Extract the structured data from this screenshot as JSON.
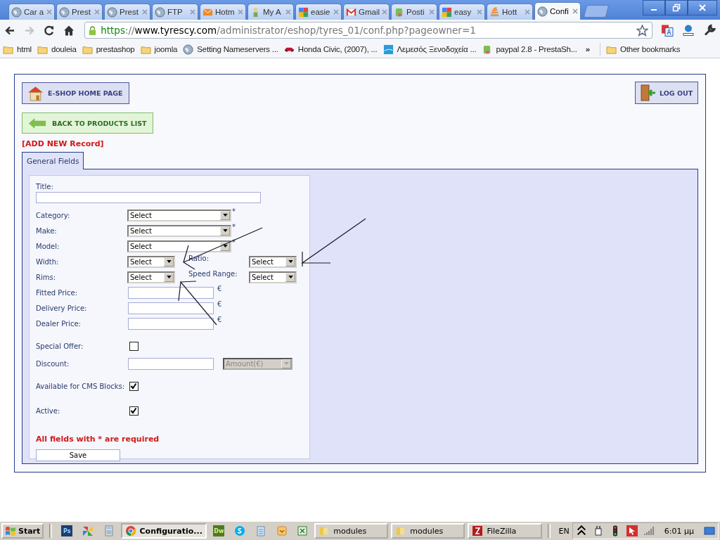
{
  "browser": {
    "tabs": [
      {
        "title": "Car a",
        "kind": "globe",
        "selected": false
      },
      {
        "title": "Prest",
        "kind": "globe",
        "selected": false
      },
      {
        "title": "Prest",
        "kind": "globe",
        "selected": false
      },
      {
        "title": "FTP",
        "kind": "globe",
        "selected": false
      },
      {
        "title": "Hotm",
        "kind": "mail",
        "selected": false
      },
      {
        "title": "My A",
        "kind": "figure",
        "selected": false
      },
      {
        "title": "easie",
        "kind": "google",
        "selected": false
      },
      {
        "title": "Gmail",
        "kind": "gmail",
        "selected": false
      },
      {
        "title": "Posti",
        "kind": "bag",
        "selected": false
      },
      {
        "title": "easy",
        "kind": "google",
        "selected": false
      },
      {
        "title": "Hott",
        "kind": "stack",
        "selected": false
      },
      {
        "title": "Confi",
        "kind": "globe",
        "selected": true
      }
    ],
    "address": [
      {
        "kind": "scheme",
        "text": "https"
      },
      {
        "kind": "dim",
        "text": "://"
      },
      {
        "kind": "host",
        "text": "www.tyrescy.com"
      },
      {
        "kind": "dim",
        "text": "/administrator/eshop/tyres_01/conf.php?pageowner=1"
      }
    ],
    "bookmarks": [
      {
        "label": "html",
        "kind": "folder"
      },
      {
        "label": "douleia",
        "kind": "folder"
      },
      {
        "label": "prestashop",
        "kind": "folder"
      },
      {
        "label": "joomla",
        "kind": "folder"
      },
      {
        "label": "Setting Nameservers ...",
        "kind": "globe"
      },
      {
        "label": "Honda Civic, (2007), ...",
        "kind": "car"
      },
      {
        "label": "Λεμεσός Ξενοδοχεία ...",
        "kind": "wave"
      },
      {
        "label": "paypal 2.8 - PrestaSh...",
        "kind": "bag"
      }
    ],
    "bookmarks_overflow": "»",
    "other_bookmarks": "Other bookmarks"
  },
  "page": {
    "home_button": "E-SHOP HOME PAGE",
    "logout_button": "LOG OUT",
    "back_button": "BACK TO PRODUCTS LIST",
    "heading": "[ADD NEW Record]",
    "tabs": [
      {
        "label": "General Fields",
        "selected": true
      }
    ],
    "title_field": {
      "label": "Title:"
    },
    "rows": [
      {
        "kind": "select",
        "label": "Category:",
        "value": "Select",
        "marker": "*"
      },
      {
        "kind": "select",
        "label": "Make:",
        "value": "Select",
        "marker": "*"
      },
      {
        "kind": "select",
        "label": "Model:",
        "value": "Select",
        "marker": "*"
      },
      {
        "kind": "pair",
        "label": "Width:",
        "value": "Select",
        "second_label": "Ratio:",
        "second_value": "Select"
      },
      {
        "kind": "pair",
        "label": "Rims:",
        "value": "Select",
        "second_label": "Speed Range:",
        "second_value": "Select"
      },
      {
        "kind": "text",
        "label": "Fitted Price:",
        "suffix": "€"
      },
      {
        "kind": "text",
        "label": "Delivery Price:",
        "suffix": "€"
      },
      {
        "kind": "text",
        "label": "Dealer Price:",
        "suffix": "€"
      },
      {
        "kind": "checkbox",
        "label": "Special Offer:",
        "checked": false
      },
      {
        "kind": "discount",
        "label": "Discount:",
        "select_value": "Amount(€)",
        "disabled": true
      },
      {
        "kind": "checkbox",
        "label": "Available for CMS Blocks:",
        "checked": true
      },
      {
        "kind": "checkbox",
        "label": "Active:",
        "checked": true
      }
    ],
    "required_note": "All fields with * are required",
    "save_button": "Save"
  },
  "taskbar": {
    "start": "Start",
    "items": [
      {
        "kind": "photoshop",
        "label": "Ps"
      },
      {
        "kind": "picasa"
      },
      {
        "kind": "calculator"
      },
      {
        "kind": "chrome",
        "label": "Configuratio...",
        "selected": true
      },
      {
        "kind": "dreamweaver",
        "label": "Dw"
      },
      {
        "kind": "skype"
      },
      {
        "kind": "notepad"
      },
      {
        "kind": "outlook"
      },
      {
        "kind": "excel"
      },
      {
        "kind": "folder",
        "label": "modules",
        "selected": false
      },
      {
        "kind": "folder",
        "label": "modules",
        "selected": false
      },
      {
        "kind": "filezilla",
        "label": "FileZilla",
        "selected": false
      }
    ],
    "language": "EN",
    "clock": "6:01 μμ"
  }
}
